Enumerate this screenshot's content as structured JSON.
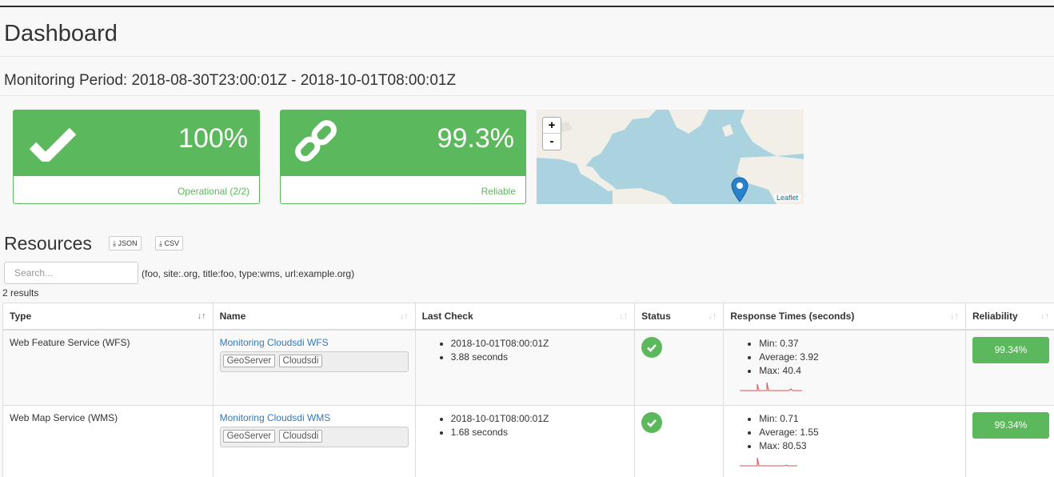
{
  "header": {
    "title": "Dashboard",
    "period": "Monitoring Period: 2018-08-30T23:00:01Z - 2018-10-01T08:00:01Z"
  },
  "panels": {
    "operational": {
      "value": "100%",
      "label": "Operational (2/2)",
      "icon": "check-icon"
    },
    "reliable": {
      "value": "99.3%",
      "label": "Reliable",
      "icon": "link-icon"
    }
  },
  "map": {
    "zoom_in": "+",
    "zoom_out": "-",
    "attribution": "Leaflet"
  },
  "resources": {
    "title": "Resources",
    "json_label": "JSON",
    "csv_label": "CSV",
    "search_placeholder": "Search...",
    "search_value": "",
    "search_hint": "(foo, site:.org, title:foo, type:wms, url:example.org)",
    "result_count": "2 results",
    "columns": [
      "Type",
      "Name",
      "Last Check",
      "Status",
      "Response Times (seconds)",
      "Reliability"
    ],
    "rows": [
      {
        "type": "Web Feature Service (WFS)",
        "name": "Monitoring Cloudsdi WFS",
        "tags": [
          "GeoServer",
          "Cloudsdi"
        ],
        "last_check": [
          "2018-10-01T08:00:01Z",
          "3.88 seconds"
        ],
        "status": "ok",
        "response": [
          "Min: 0.37",
          "Average: 3.92",
          "Max: 40.4"
        ],
        "reliability": "99.34%"
      },
      {
        "type": "Web Map Service (WMS)",
        "name": "Monitoring Cloudsdi WMS",
        "tags": [
          "GeoServer",
          "Cloudsdi"
        ],
        "last_check": [
          "2018-10-01T08:00:01Z",
          "1.68 seconds"
        ],
        "status": "ok",
        "response": [
          "Min: 0.71",
          "Average: 1.55",
          "Max: 80.53"
        ],
        "reliability": "99.34%"
      }
    ]
  },
  "colors": {
    "success": "#5cb85c",
    "link": "#337ab7",
    "water": "#aad3df",
    "marker": "#2a81cb"
  }
}
